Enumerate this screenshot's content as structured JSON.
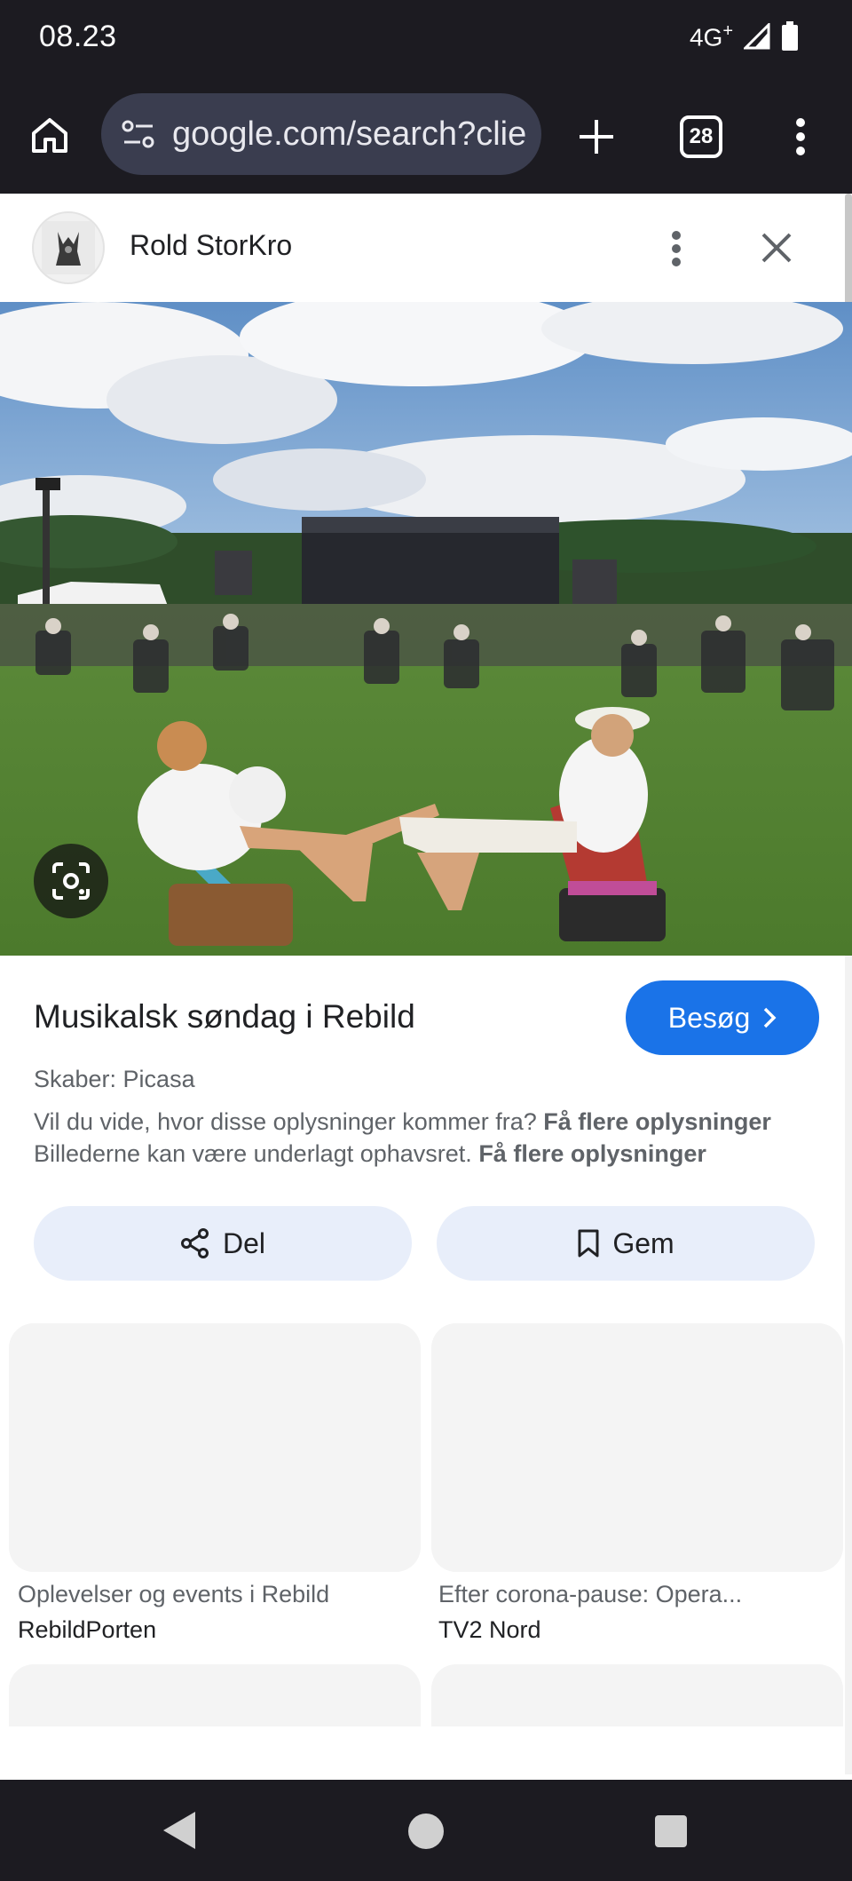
{
  "status_bar": {
    "time": "08.23",
    "network": "4G",
    "network_plus": "+"
  },
  "browser": {
    "url": "google.com/search?clie",
    "tab_count": "28"
  },
  "panel": {
    "site_name": "Rold StorKro"
  },
  "result": {
    "title": "Musikalsk søndag i Rebild",
    "visit_label": "Besøg",
    "creator": "Skaber: Picasa",
    "info_line1_text": "Vil du vide, hvor disse oplysninger kommer fra?",
    "info_line1_link": "Få flere oplysninger",
    "info_line2_text": "Billederne kan være underlagt ophavsret.",
    "info_line2_link": "Få flere oplysninger",
    "share_label": "Del",
    "save_label": "Gem"
  },
  "related": [
    {
      "title": "Oplevelser og events i Rebild",
      "source": "RebildPorten"
    },
    {
      "title": "Efter corona-pause: Opera...",
      "source": "TV2 Nord"
    }
  ],
  "colors": {
    "accent": "#1a73e8",
    "chrome_dark": "#1c1b21",
    "url_pill": "#3a3d4f",
    "action_button_bg": "#e8eefa"
  },
  "icons": {
    "toolbar": [
      "home-icon",
      "site-settings-icon",
      "new-tab-plus-icon",
      "tab-switcher-icon",
      "overflow-menu-icon"
    ],
    "panel": [
      "more-vert-icon",
      "close-icon",
      "lens-search-icon",
      "chevron-right-icon",
      "share-icon",
      "bookmark-icon"
    ],
    "nav": [
      "back-triangle-icon",
      "home-circle-icon",
      "recents-square-icon"
    ]
  }
}
